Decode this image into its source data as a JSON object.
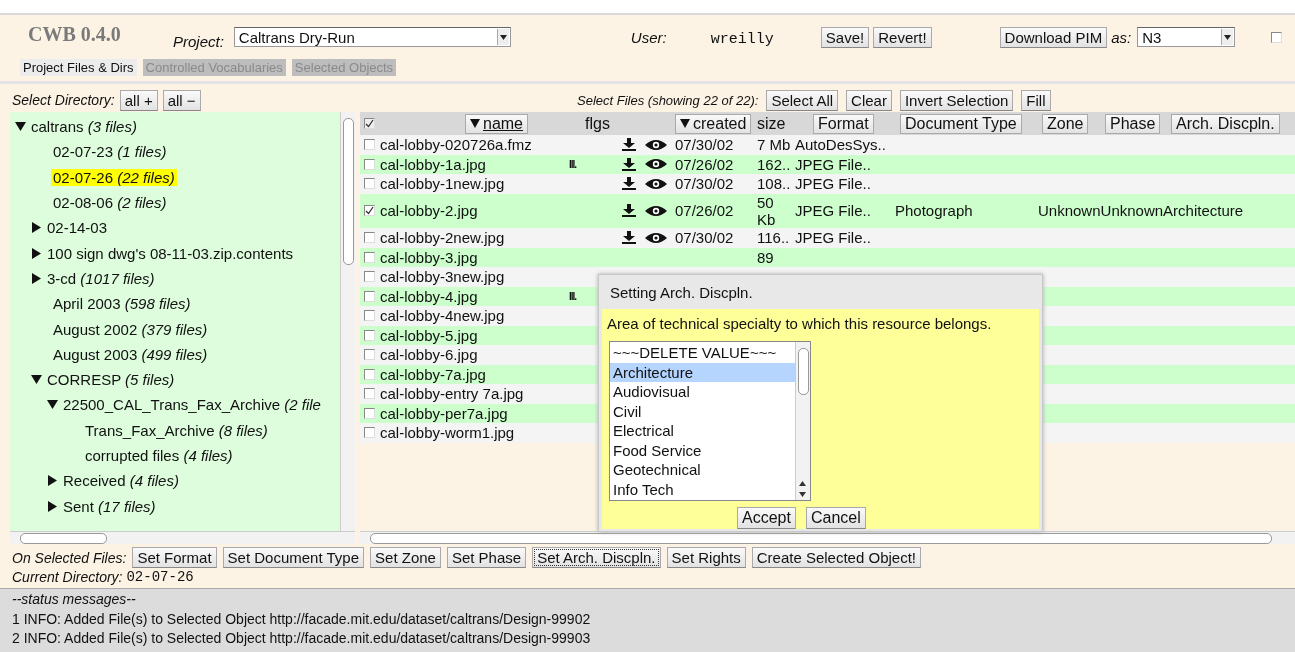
{
  "header": {
    "logo": "CWB 0.4.0",
    "project_label": "Project:",
    "project": "Caltrans Dry-Run",
    "user_label": "User:",
    "user": "wreilly",
    "buttons": [
      "Save!",
      "Revert!"
    ],
    "download_button": "Download PIM",
    "format_label": "as:",
    "format": "N3",
    "option_checkbox": {
      "checked": false
    }
  },
  "tabs": [
    {
      "label": "Project Files & Dirs",
      "selected": true
    },
    {
      "label": "Controlled Vocabularies",
      "selected": false
    },
    {
      "label": "Selected Objects",
      "selected": false
    }
  ],
  "directory_panel": {
    "label": "Select Directory:",
    "buttons": [
      "all +",
      "all −"
    ],
    "tree": [
      {
        "name": "caltrans",
        "count": "(3 files)",
        "expanded": true,
        "selected": false,
        "children": [
          {
            "name": "02-07-23",
            "count": "(1 files)",
            "selected": false
          },
          {
            "name": "02-07-26",
            "count": "(22 files)",
            "selected": true
          },
          {
            "name": "02-08-06",
            "count": "(2 files)",
            "selected": false
          },
          {
            "name": "02-14-03",
            "expanded": false,
            "selected": false
          },
          {
            "name": "100 sign dwg's 08-11-03.zip.contents",
            "expanded": false,
            "selected": false
          },
          {
            "name": "3-cd",
            "count": "(1017 files)",
            "expanded": false,
            "selected": false
          },
          {
            "name": "April 2003",
            "count": "(598 files)",
            "selected": false
          },
          {
            "name": "August 2002",
            "count": "(379 files)",
            "selected": false
          },
          {
            "name": "August 2003",
            "count": "(499 files)",
            "selected": false
          },
          {
            "name": "CORRESP",
            "count": "(5 files)",
            "expanded": true,
            "selected": false,
            "children": [
              {
                "name": "22500_CAL_Trans_Fax_Archive",
                "count": "(2 file",
                "expanded": true,
                "selected": false,
                "children": [
                  {
                    "name": "Trans_Fax_Archive",
                    "count": "(8 files)",
                    "selected": false
                  },
                  {
                    "name": "corrupted files",
                    "count": "(4 files)",
                    "selected": false
                  }
                ]
              },
              {
                "name": "Received",
                "count": "(4 files)",
                "expanded": false,
                "selected": false
              },
              {
                "name": "Sent",
                "count": "(17 files)",
                "expanded": false,
                "selected": false
              }
            ]
          }
        ]
      }
    ]
  },
  "files_panel": {
    "label": "Select Files (showing 22 of 22):",
    "buttons": [
      "Select All",
      "Clear",
      "Invert Selection",
      "Fill"
    ],
    "all_checked": true,
    "columns": [
      {
        "label": "name",
        "kind": "button",
        "sorted": true,
        "selected": true
      },
      {
        "label": "flgs",
        "kind": "plain",
        "sorted": false,
        "selected": false
      },
      {
        "label": "created",
        "kind": "button",
        "sorted": true,
        "selected": false
      },
      {
        "label": "size",
        "kind": "plain",
        "sorted": false,
        "selected": false
      },
      {
        "label": "Format",
        "kind": "button",
        "sorted": false,
        "selected": false
      },
      {
        "label": "Document Type",
        "kind": "button",
        "sorted": false,
        "selected": false
      },
      {
        "label": "Zone",
        "kind": "button",
        "sorted": false,
        "selected": false
      },
      {
        "label": "Phase",
        "kind": "button",
        "sorted": false,
        "selected": false
      },
      {
        "label": "Arch. Discpln.",
        "kind": "button",
        "sorted": false,
        "selected": false
      }
    ],
    "rows": [
      {
        "checked": false,
        "name": "cal-lobby-020726a.fmz",
        "download": true,
        "view": true,
        "created": "07/30/02",
        "size": "7 Mb",
        "format": "AutoDesSys.."
      },
      {
        "checked": false,
        "name": "cal-lobby-1a.jpg",
        "flags": "lll.",
        "download": true,
        "view": true,
        "created": "07/26/02",
        "size": "162..",
        "format": "JPEG File.."
      },
      {
        "checked": false,
        "name": "cal-lobby-1new.jpg",
        "download": true,
        "view": true,
        "created": "07/30/02",
        "size": "108..",
        "format": "JPEG File.."
      },
      {
        "checked": true,
        "name": "cal-lobby-2.jpg",
        "download": true,
        "view": true,
        "created": "07/26/02",
        "size": "50 Kb",
        "format": "JPEG File..",
        "document_type": "Photograph",
        "zone": "Unknown",
        "phase": "Unknown",
        "discipline": "Architecture"
      },
      {
        "checked": false,
        "name": "cal-lobby-2new.jpg",
        "download": true,
        "view": true,
        "created": "07/30/02",
        "size": "116..",
        "format": "JPEG File.."
      },
      {
        "checked": false,
        "name": "cal-lobby-3.jpg",
        "size": "89"
      },
      {
        "checked": false,
        "name": "cal-lobby-3new.jpg"
      },
      {
        "checked": false,
        "name": "cal-lobby-4.jpg",
        "flags": "lll."
      },
      {
        "checked": false,
        "name": "cal-lobby-4new.jpg"
      },
      {
        "checked": false,
        "name": "cal-lobby-5.jpg"
      },
      {
        "checked": false,
        "name": "cal-lobby-6.jpg"
      },
      {
        "checked": false,
        "name": "cal-lobby-7a.jpg"
      },
      {
        "checked": false,
        "name": "cal-lobby-entry 7a.jpg"
      },
      {
        "checked": false,
        "name": "cal-lobby-per7a.jpg"
      },
      {
        "checked": false,
        "name": "cal-lobby-worm1.jpg"
      }
    ]
  },
  "dialog": {
    "title": "Setting Arch. Discpln.",
    "description": "Area of technical specialty to which this resource belongs.",
    "options": [
      {
        "label": "~~~DELETE VALUE~~~",
        "selected": false
      },
      {
        "label": "Architecture",
        "selected": true
      },
      {
        "label": "Audiovisual",
        "selected": false
      },
      {
        "label": "Civil",
        "selected": false
      },
      {
        "label": "Electrical",
        "selected": false
      },
      {
        "label": "Food Service",
        "selected": false
      },
      {
        "label": "Geotechnical",
        "selected": false
      },
      {
        "label": "Info Tech",
        "selected": false
      }
    ],
    "buttons": [
      "Accept",
      "Cancel"
    ]
  },
  "actions": {
    "label": "On Selected Files:",
    "buttons": [
      {
        "label": "Set Format",
        "focused": false
      },
      {
        "label": "Set Document Type",
        "focused": false
      },
      {
        "label": "Set Zone",
        "focused": false
      },
      {
        "label": "Set Phase",
        "focused": false
      },
      {
        "label": "Set Arch. Discpln.",
        "focused": true
      },
      {
        "label": "Set Rights",
        "focused": false
      },
      {
        "label": "Create Selected Object!",
        "focused": false
      }
    ]
  },
  "current_directory": {
    "label": "Current Directory:",
    "value": "02-07-26"
  },
  "status": {
    "title": "--status messages--",
    "messages": [
      "1 INFO: Added File(s) to Selected Object http://facade.mit.edu/dataset/caltrans/Design-99902",
      "2 INFO: Added File(s) to Selected Object http://facade.mit.edu/dataset/caltrans/Design-99903"
    ]
  }
}
